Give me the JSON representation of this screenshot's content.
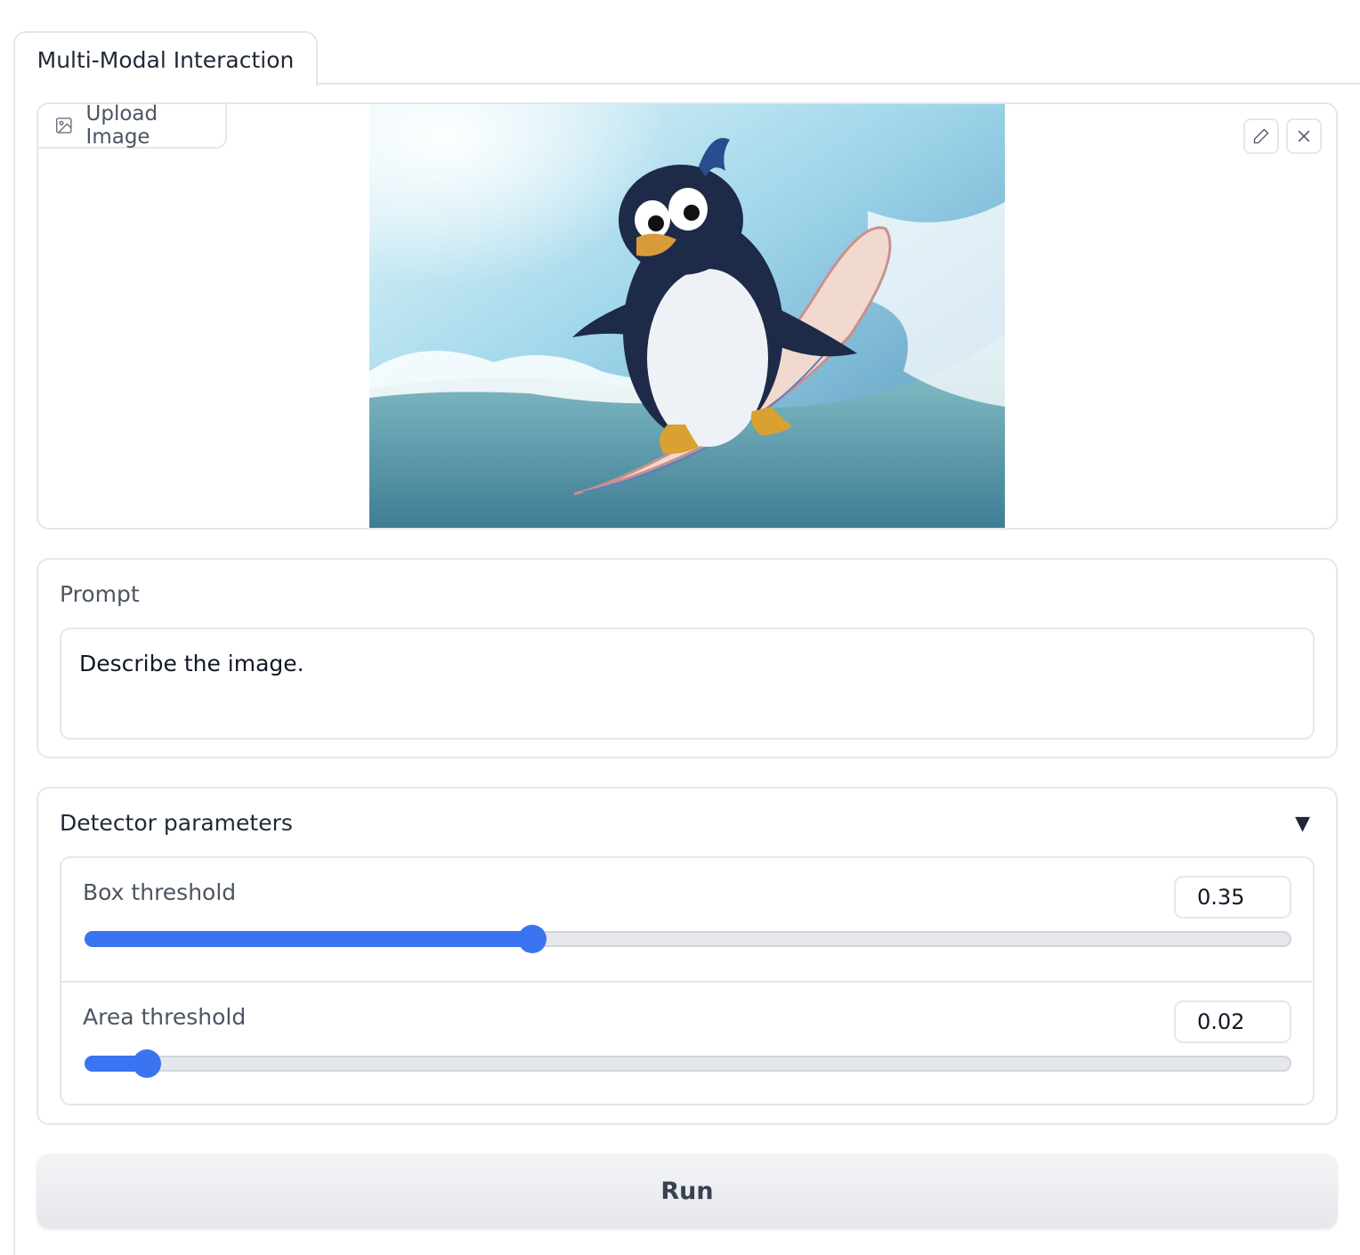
{
  "tabs": [
    {
      "label": "Multi-Modal Interaction",
      "active": true
    }
  ],
  "image_input": {
    "label": "Upload Image",
    "label_icon": "image-icon",
    "toolbar": {
      "edit_icon": "pencil-icon",
      "clear_icon": "close-icon"
    }
  },
  "prompt": {
    "label": "Prompt",
    "value": "Describe the image."
  },
  "detector": {
    "title": "Detector parameters",
    "toggle_icon": "triangle-down-icon",
    "expanded": true,
    "sliders": [
      {
        "label": "Box threshold",
        "value": "0.35",
        "fraction": 0.35
      },
      {
        "label": "Area threshold",
        "value": "0.02",
        "fraction": 0.02
      }
    ]
  },
  "actions": {
    "run_label": "Run"
  },
  "colors": {
    "accent": "#3b74f0",
    "border": "#e5e7eb",
    "label": "#4b5563"
  }
}
